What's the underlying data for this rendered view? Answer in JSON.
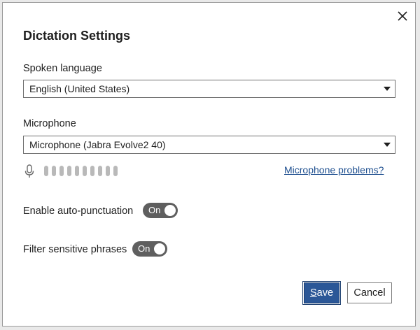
{
  "dialog": {
    "title": "Dictation Settings"
  },
  "language": {
    "label": "Spoken language",
    "selected": "English (United States)"
  },
  "microphone": {
    "label": "Microphone",
    "selected": "Microphone (Jabra Evolve2 40)",
    "level_bars": 10,
    "level_active": 0,
    "problems_link": "Microphone problems?"
  },
  "auto_punctuation": {
    "label": "Enable auto-punctuation",
    "state": "On"
  },
  "filter_phrases": {
    "label": "Filter sensitive phrases",
    "state": "On"
  },
  "buttons": {
    "save_accel": "S",
    "save_rest": "ave",
    "cancel": "Cancel"
  },
  "colors": {
    "primary": "#2b5797",
    "link": "#1e4f8f",
    "toggle_on": "#5f5f5f",
    "meter_idle": "#b9b9b9"
  },
  "icons": {
    "close": "close-icon",
    "dropdown": "chevron-down-icon",
    "mic": "microphone-icon"
  }
}
